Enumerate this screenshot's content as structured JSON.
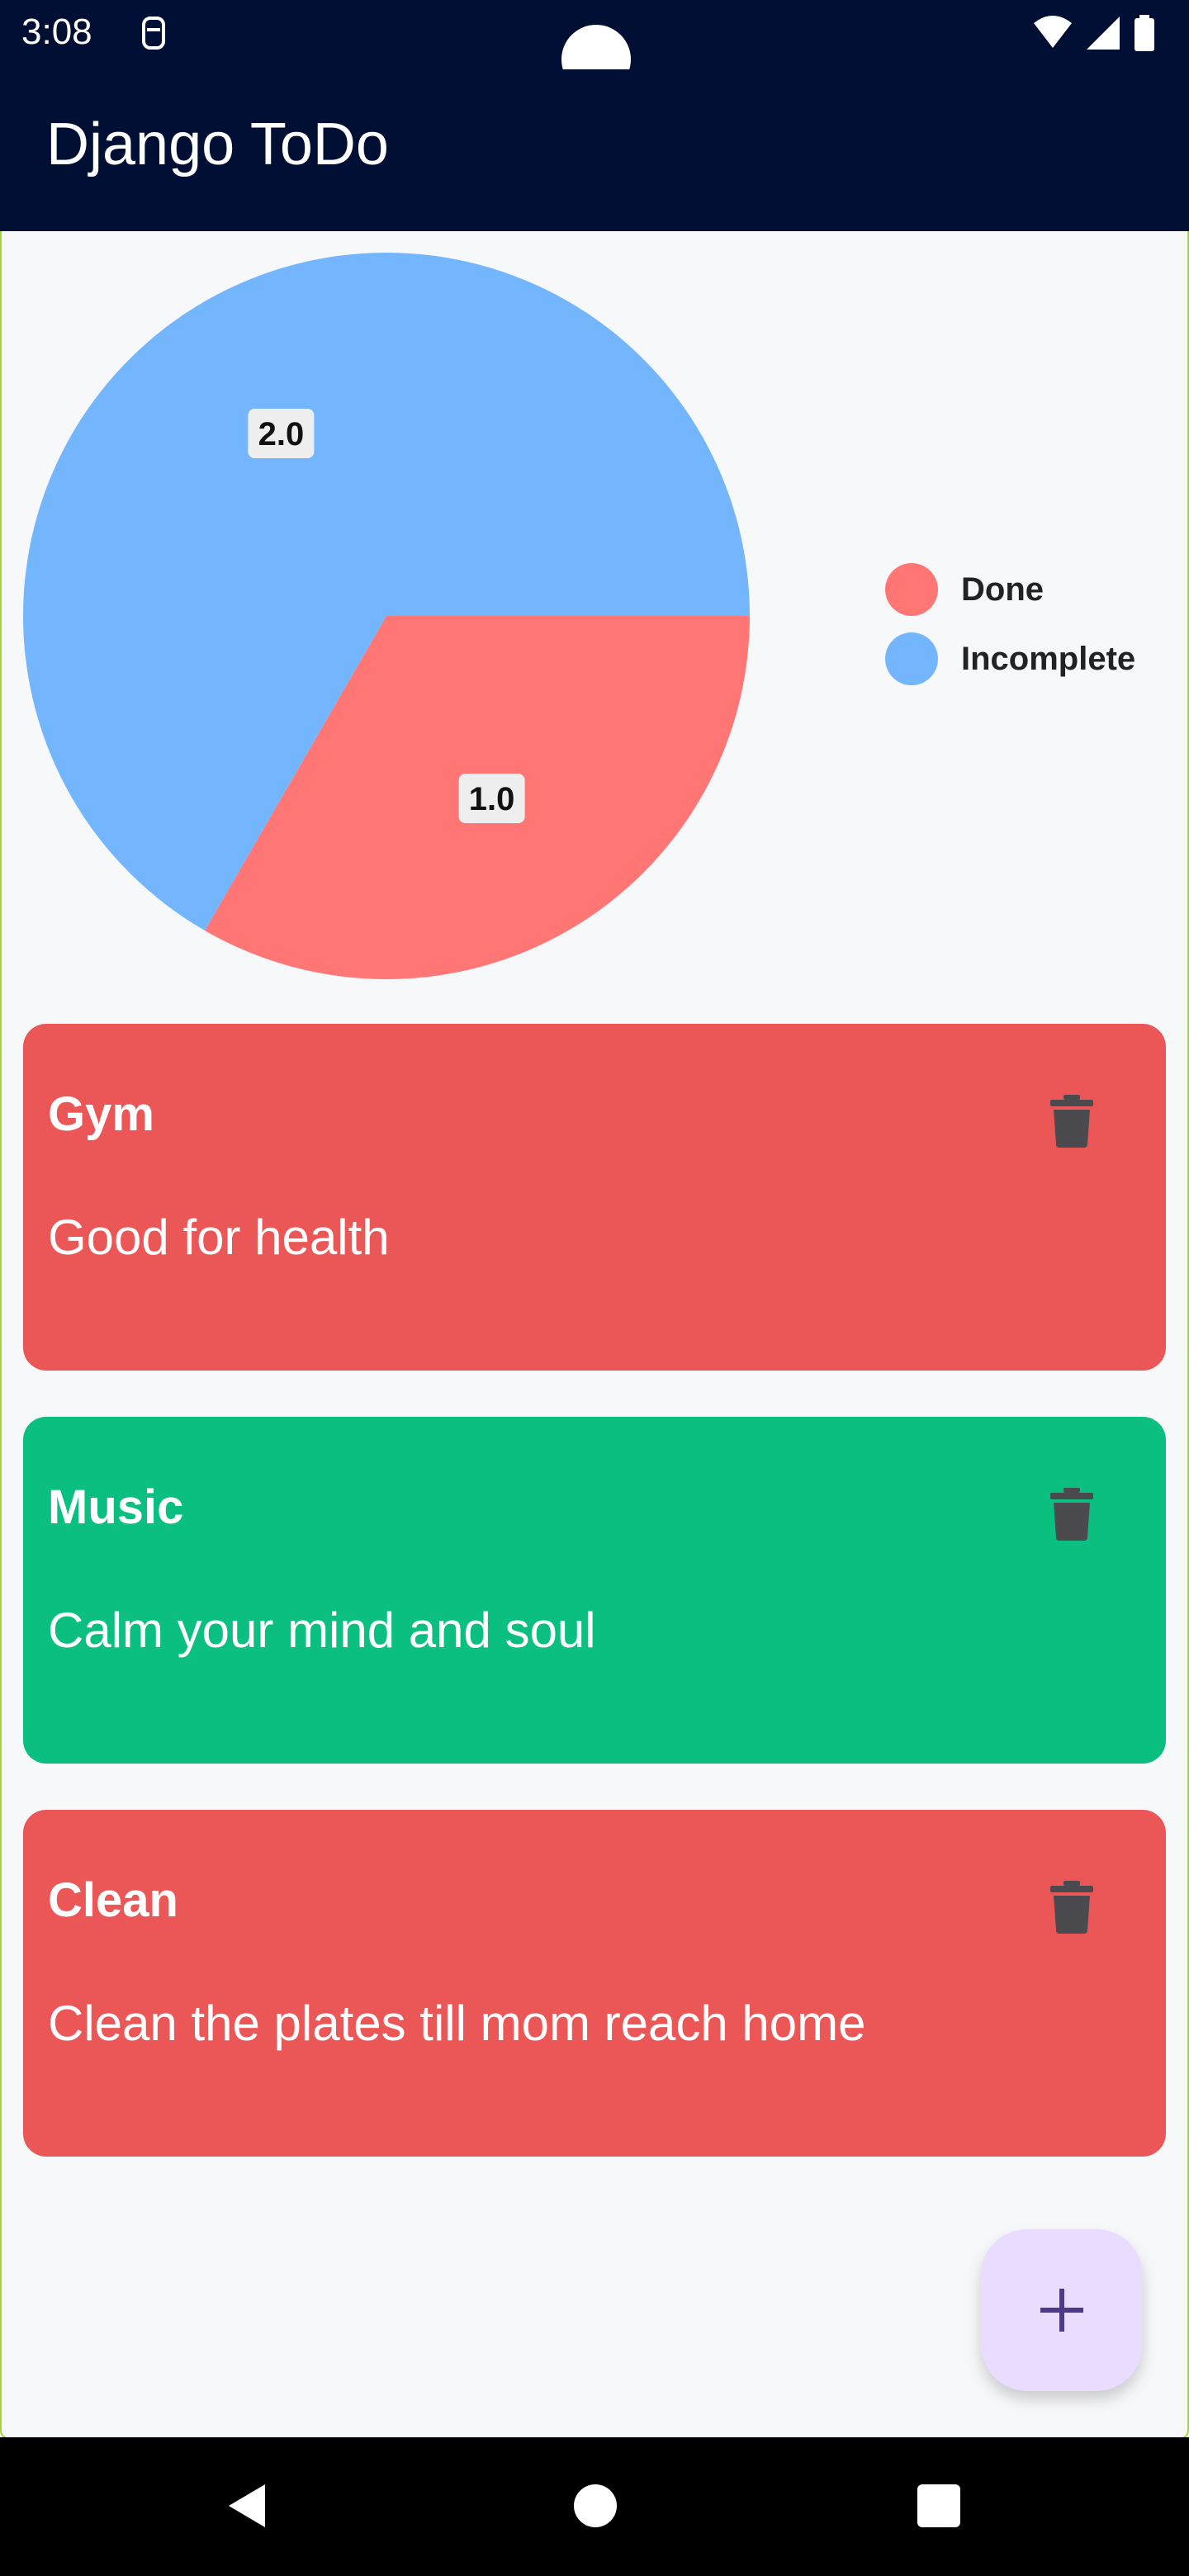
{
  "status_bar": {
    "time": "3:08"
  },
  "app_bar": {
    "title": "Django ToDo"
  },
  "chart_data": {
    "type": "pie",
    "slices": [
      {
        "name": "Done",
        "value": 1.0,
        "label": "1.0",
        "color": "#ff7675"
      },
      {
        "name": "Incomplete",
        "value": 2.0,
        "label": "2.0",
        "color": "#74b6fe"
      }
    ]
  },
  "legend": {
    "items": [
      {
        "label": "Done",
        "color": "#ff7675"
      },
      {
        "label": "Incomplete",
        "color": "#74b6fe"
      }
    ]
  },
  "todos": [
    {
      "title": "Gym",
      "description": "Good for health",
      "status": "incomplete",
      "color": "#eb5757"
    },
    {
      "title": "Music",
      "description": "Calm your mind and soul",
      "status": "done",
      "color": "#0bbf80"
    },
    {
      "title": "Clean",
      "description": "Clean the plates till mom reach home",
      "status": "incomplete",
      "color": "#eb5757"
    }
  ],
  "icons": {
    "delete": "trash-icon",
    "add": "plus-icon",
    "nav": [
      "back-icon",
      "home-icon",
      "recents-icon"
    ]
  },
  "colors": {
    "app_bar": "#000f33",
    "fab": "#eadcff",
    "fab_icon": "#4a3a87",
    "delete_icon": "#4a4a4f"
  }
}
